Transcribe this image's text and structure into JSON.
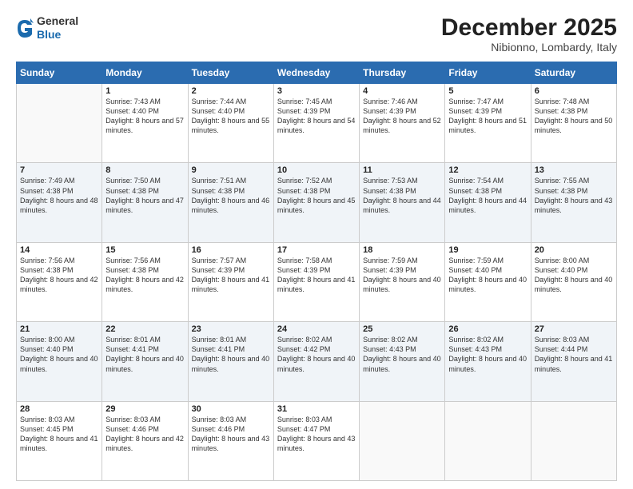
{
  "logo": {
    "general": "General",
    "blue": "Blue"
  },
  "header": {
    "month": "December 2025",
    "location": "Nibionno, Lombardy, Italy"
  },
  "days_of_week": [
    "Sunday",
    "Monday",
    "Tuesday",
    "Wednesday",
    "Thursday",
    "Friday",
    "Saturday"
  ],
  "weeks": [
    [
      {
        "day": "",
        "sunrise": "",
        "sunset": "",
        "daylight": ""
      },
      {
        "day": "1",
        "sunrise": "Sunrise: 7:43 AM",
        "sunset": "Sunset: 4:40 PM",
        "daylight": "Daylight: 8 hours and 57 minutes."
      },
      {
        "day": "2",
        "sunrise": "Sunrise: 7:44 AM",
        "sunset": "Sunset: 4:40 PM",
        "daylight": "Daylight: 8 hours and 55 minutes."
      },
      {
        "day": "3",
        "sunrise": "Sunrise: 7:45 AM",
        "sunset": "Sunset: 4:39 PM",
        "daylight": "Daylight: 8 hours and 54 minutes."
      },
      {
        "day": "4",
        "sunrise": "Sunrise: 7:46 AM",
        "sunset": "Sunset: 4:39 PM",
        "daylight": "Daylight: 8 hours and 52 minutes."
      },
      {
        "day": "5",
        "sunrise": "Sunrise: 7:47 AM",
        "sunset": "Sunset: 4:39 PM",
        "daylight": "Daylight: 8 hours and 51 minutes."
      },
      {
        "day": "6",
        "sunrise": "Sunrise: 7:48 AM",
        "sunset": "Sunset: 4:38 PM",
        "daylight": "Daylight: 8 hours and 50 minutes."
      }
    ],
    [
      {
        "day": "7",
        "sunrise": "Sunrise: 7:49 AM",
        "sunset": "Sunset: 4:38 PM",
        "daylight": "Daylight: 8 hours and 48 minutes."
      },
      {
        "day": "8",
        "sunrise": "Sunrise: 7:50 AM",
        "sunset": "Sunset: 4:38 PM",
        "daylight": "Daylight: 8 hours and 47 minutes."
      },
      {
        "day": "9",
        "sunrise": "Sunrise: 7:51 AM",
        "sunset": "Sunset: 4:38 PM",
        "daylight": "Daylight: 8 hours and 46 minutes."
      },
      {
        "day": "10",
        "sunrise": "Sunrise: 7:52 AM",
        "sunset": "Sunset: 4:38 PM",
        "daylight": "Daylight: 8 hours and 45 minutes."
      },
      {
        "day": "11",
        "sunrise": "Sunrise: 7:53 AM",
        "sunset": "Sunset: 4:38 PM",
        "daylight": "Daylight: 8 hours and 44 minutes."
      },
      {
        "day": "12",
        "sunrise": "Sunrise: 7:54 AM",
        "sunset": "Sunset: 4:38 PM",
        "daylight": "Daylight: 8 hours and 44 minutes."
      },
      {
        "day": "13",
        "sunrise": "Sunrise: 7:55 AM",
        "sunset": "Sunset: 4:38 PM",
        "daylight": "Daylight: 8 hours and 43 minutes."
      }
    ],
    [
      {
        "day": "14",
        "sunrise": "Sunrise: 7:56 AM",
        "sunset": "Sunset: 4:38 PM",
        "daylight": "Daylight: 8 hours and 42 minutes."
      },
      {
        "day": "15",
        "sunrise": "Sunrise: 7:56 AM",
        "sunset": "Sunset: 4:38 PM",
        "daylight": "Daylight: 8 hours and 42 minutes."
      },
      {
        "day": "16",
        "sunrise": "Sunrise: 7:57 AM",
        "sunset": "Sunset: 4:39 PM",
        "daylight": "Daylight: 8 hours and 41 minutes."
      },
      {
        "day": "17",
        "sunrise": "Sunrise: 7:58 AM",
        "sunset": "Sunset: 4:39 PM",
        "daylight": "Daylight: 8 hours and 41 minutes."
      },
      {
        "day": "18",
        "sunrise": "Sunrise: 7:59 AM",
        "sunset": "Sunset: 4:39 PM",
        "daylight": "Daylight: 8 hours and 40 minutes."
      },
      {
        "day": "19",
        "sunrise": "Sunrise: 7:59 AM",
        "sunset": "Sunset: 4:40 PM",
        "daylight": "Daylight: 8 hours and 40 minutes."
      },
      {
        "day": "20",
        "sunrise": "Sunrise: 8:00 AM",
        "sunset": "Sunset: 4:40 PM",
        "daylight": "Daylight: 8 hours and 40 minutes."
      }
    ],
    [
      {
        "day": "21",
        "sunrise": "Sunrise: 8:00 AM",
        "sunset": "Sunset: 4:40 PM",
        "daylight": "Daylight: 8 hours and 40 minutes."
      },
      {
        "day": "22",
        "sunrise": "Sunrise: 8:01 AM",
        "sunset": "Sunset: 4:41 PM",
        "daylight": "Daylight: 8 hours and 40 minutes."
      },
      {
        "day": "23",
        "sunrise": "Sunrise: 8:01 AM",
        "sunset": "Sunset: 4:41 PM",
        "daylight": "Daylight: 8 hours and 40 minutes."
      },
      {
        "day": "24",
        "sunrise": "Sunrise: 8:02 AM",
        "sunset": "Sunset: 4:42 PM",
        "daylight": "Daylight: 8 hours and 40 minutes."
      },
      {
        "day": "25",
        "sunrise": "Sunrise: 8:02 AM",
        "sunset": "Sunset: 4:43 PM",
        "daylight": "Daylight: 8 hours and 40 minutes."
      },
      {
        "day": "26",
        "sunrise": "Sunrise: 8:02 AM",
        "sunset": "Sunset: 4:43 PM",
        "daylight": "Daylight: 8 hours and 40 minutes."
      },
      {
        "day": "27",
        "sunrise": "Sunrise: 8:03 AM",
        "sunset": "Sunset: 4:44 PM",
        "daylight": "Daylight: 8 hours and 41 minutes."
      }
    ],
    [
      {
        "day": "28",
        "sunrise": "Sunrise: 8:03 AM",
        "sunset": "Sunset: 4:45 PM",
        "daylight": "Daylight: 8 hours and 41 minutes."
      },
      {
        "day": "29",
        "sunrise": "Sunrise: 8:03 AM",
        "sunset": "Sunset: 4:46 PM",
        "daylight": "Daylight: 8 hours and 42 minutes."
      },
      {
        "day": "30",
        "sunrise": "Sunrise: 8:03 AM",
        "sunset": "Sunset: 4:46 PM",
        "daylight": "Daylight: 8 hours and 43 minutes."
      },
      {
        "day": "31",
        "sunrise": "Sunrise: 8:03 AM",
        "sunset": "Sunset: 4:47 PM",
        "daylight": "Daylight: 8 hours and 43 minutes."
      },
      {
        "day": "",
        "sunrise": "",
        "sunset": "",
        "daylight": ""
      },
      {
        "day": "",
        "sunrise": "",
        "sunset": "",
        "daylight": ""
      },
      {
        "day": "",
        "sunrise": "",
        "sunset": "",
        "daylight": ""
      }
    ]
  ]
}
